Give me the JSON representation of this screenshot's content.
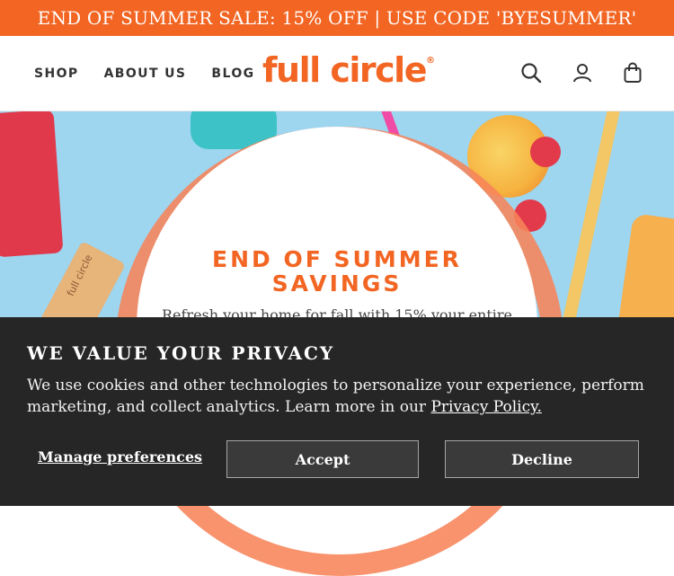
{
  "promo": {
    "text": "END OF SUMMER SALE: 15% OFF | USE CODE 'BYESUMMER'"
  },
  "nav": {
    "items": [
      "SHOP",
      "ABOUT US",
      "BLOG"
    ]
  },
  "logo": {
    "text": "full circle",
    "mark": "®"
  },
  "header_icons": [
    "search-icon",
    "account-icon",
    "cart-bag-icon"
  ],
  "hero": {
    "title_line1": "END OF SUMMER",
    "title_line2": "SAVINGS",
    "subtitle": "Refresh your home for fall with 15% your entire",
    "stick_text": "full circle"
  },
  "cookie_banner": {
    "title": "WE VALUE YOUR PRIVACY",
    "body": "We use cookies and other technologies to personalize your experience, perform marketing, and collect analytics. Learn more in our",
    "policy_link": "Privacy Policy.",
    "manage_label": "Manage preferences",
    "accept_label": "Accept",
    "decline_label": "Decline"
  },
  "colors": {
    "brand_orange": "#f26522",
    "hero_bg": "#9ed5ef",
    "banner_bg": "#262626",
    "button_bg": "#3a3a3a"
  }
}
